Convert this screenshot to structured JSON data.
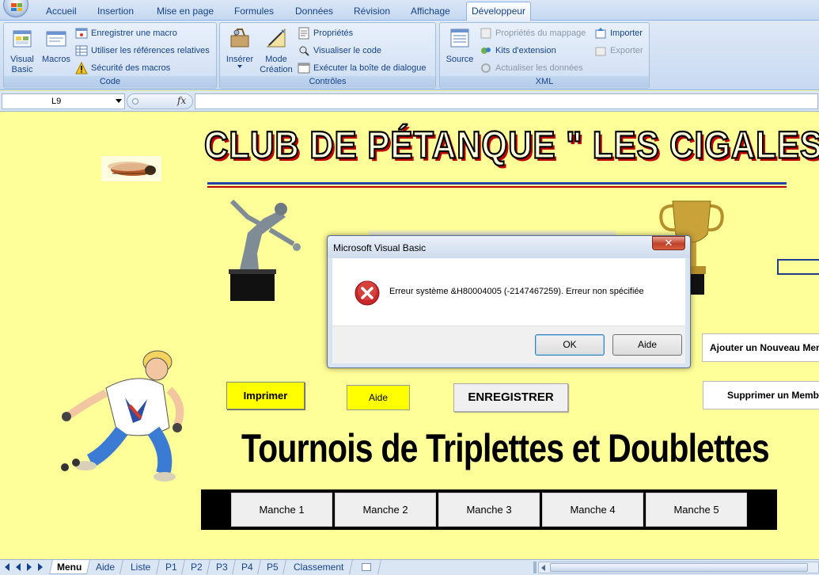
{
  "ribbon": {
    "tabs": [
      "Accueil",
      "Insertion",
      "Mise en page",
      "Formules",
      "Données",
      "Révision",
      "Affichage",
      "Développeur"
    ],
    "active_tab": "Développeur",
    "groups": {
      "code": {
        "label": "Code",
        "visual_basic": "Visual\nBasic",
        "macros": "Macros",
        "record_macro": "Enregistrer une macro",
        "relative_refs": "Utiliser les références relatives",
        "macro_security": "Sécurité des macros"
      },
      "controles": {
        "label": "Contrôles",
        "inserer": "Insérer",
        "mode_creation": "Mode\nCréation",
        "proprietes": "Propriétés",
        "visualiser_code": "Visualiser le code",
        "executer_dialogue": "Exécuter la boîte de dialogue"
      },
      "xml": {
        "label": "XML",
        "source": "Source",
        "proprietes_mappage": "Propriétés du mappage",
        "kits_extension": "Kits d'extension",
        "actualiser": "Actualiser les données",
        "importer": "Importer",
        "exporter": "Exporter"
      }
    }
  },
  "formula_bar": {
    "name_box": "L9",
    "fx": "fx",
    "formula": ""
  },
  "sheet": {
    "club_title": "Club de Pétanque \" Les Cigales \"",
    "tournois_title": "Tournois de Triplettes et Doublettes",
    "buttons": {
      "imprimer": "Imprimer",
      "aide": "Aide",
      "enregistrer": "ENREGISTRER",
      "ajouter": "Ajouter un Nouveau Membre",
      "supprimer": "Supprimer un Membre"
    },
    "manches": [
      "Manche 1",
      "Manche 2",
      "Manche 3",
      "Manche 4",
      "Manche 5"
    ]
  },
  "dialog": {
    "title": "Microsoft Visual Basic",
    "close": "✕",
    "message": "Erreur système &H80004005 (-2147467259).   Erreur non spécifiée",
    "ok": "OK",
    "aide": "Aide"
  },
  "sheet_tabs": {
    "tabs": [
      "Menu",
      "Aide",
      "Liste",
      "P1",
      "P2",
      "P3",
      "P4",
      "P5",
      "Classement"
    ],
    "active": "Menu"
  },
  "colors": {
    "sheet_bg": "#ffff99",
    "accent_red": "#c00000",
    "button_yellow": "#ffff00"
  }
}
